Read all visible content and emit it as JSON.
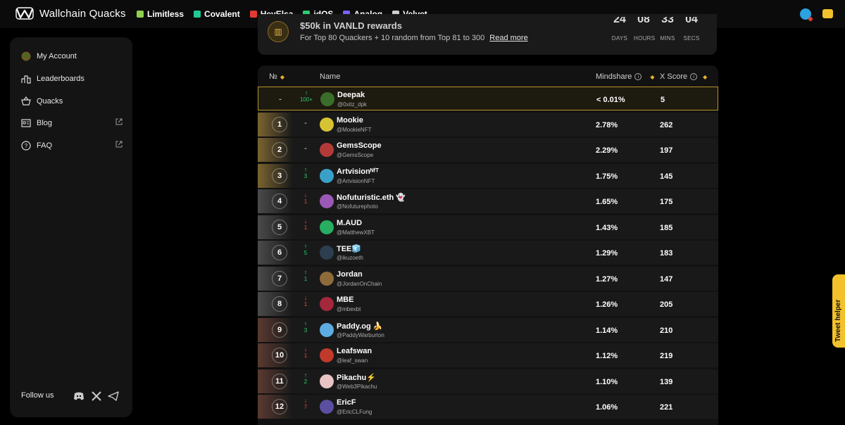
{
  "brand": {
    "name": "Wallchain Quacks"
  },
  "partners": [
    {
      "label": "Limitless",
      "color": "#8fd14f"
    },
    {
      "label": "Covalent",
      "color": "#20c997"
    },
    {
      "label": "HeyElsa",
      "color": "#e53935"
    },
    {
      "label": "idOS",
      "color": "#2ecc71"
    },
    {
      "label": "Analog",
      "color": "#7b61ff"
    },
    {
      "label": "Velvet",
      "color": "#d0d0d0"
    }
  ],
  "sidebar": {
    "items": [
      {
        "label": "My Account",
        "icon": "avatar-icon"
      },
      {
        "label": "Leaderboards",
        "icon": "chart-icon"
      },
      {
        "label": "Quacks",
        "icon": "basket-icon"
      },
      {
        "label": "Blog",
        "icon": "newspaper-icon",
        "external": true
      },
      {
        "label": "FAQ",
        "icon": "question-icon",
        "external": true
      }
    ],
    "follow_label": "Follow us"
  },
  "reward": {
    "title": "$50k in VANLD rewards",
    "description": "For Top 80 Quackers + 10 random from Top 81 to 300",
    "link": "Read more",
    "countdown": [
      {
        "value": "24",
        "label": "DAYS"
      },
      {
        "value": "08",
        "label": "HOURS"
      },
      {
        "value": "33",
        "label": "MINS"
      },
      {
        "value": "04",
        "label": "SECS"
      }
    ]
  },
  "table": {
    "headers": {
      "rank": "№",
      "name": "Name",
      "mindshare": "Mindshare",
      "xscore": "X Score"
    },
    "rows": [
      {
        "rank": "-",
        "change": "100+",
        "dir": "up",
        "name": "Deepak",
        "handle": "@0xitz_dpk",
        "mindshare": "< 0.01%",
        "xscore": "5",
        "me": true,
        "avatar": "#3b6d2a"
      },
      {
        "rank": "1",
        "change": "-",
        "dir": "none",
        "name": "Mookie",
        "handle": "@MookieNFT",
        "mindshare": "2.78%",
        "xscore": "262",
        "avatar": "#d6c233"
      },
      {
        "rank": "2",
        "change": "-",
        "dir": "none",
        "name": "GemsScope",
        "handle": "@GemsScope",
        "mindshare": "2.29%",
        "xscore": "197",
        "avatar": "#b43a3a"
      },
      {
        "rank": "3",
        "change": "3",
        "dir": "up",
        "name": "Artvisionᴺᶠᵀ",
        "handle": "@ArtvisionNFT",
        "mindshare": "1.75%",
        "xscore": "145",
        "avatar": "#3aa0c8"
      },
      {
        "rank": "4",
        "change": "1",
        "dir": "down",
        "name": "Nofuturistic.eth 👻",
        "handle": "@Nofuturephoto",
        "mindshare": "1.65%",
        "xscore": "175",
        "avatar": "#9b59b6"
      },
      {
        "rank": "5",
        "change": "1",
        "dir": "down",
        "name": "M.AUD",
        "handle": "@MatthewXBT",
        "mindshare": "1.43%",
        "xscore": "185",
        "avatar": "#27ae60"
      },
      {
        "rank": "6",
        "change": "5",
        "dir": "up",
        "name": "TEE🧊",
        "handle": "@ikuzoeth",
        "mindshare": "1.29%",
        "xscore": "183",
        "avatar": "#2c3e50"
      },
      {
        "rank": "7",
        "change": "1",
        "dir": "up",
        "name": "Jordan",
        "handle": "@JordanOnChain",
        "mindshare": "1.27%",
        "xscore": "147",
        "avatar": "#8e6b3a"
      },
      {
        "rank": "8",
        "change": "1",
        "dir": "down",
        "name": "MBE",
        "handle": "@mbexbt",
        "mindshare": "1.26%",
        "xscore": "205",
        "avatar": "#a3283a"
      },
      {
        "rank": "9",
        "change": "3",
        "dir": "up",
        "name": "Paddy.og 🍌",
        "handle": "@PaddyWarburton",
        "mindshare": "1.14%",
        "xscore": "210",
        "avatar": "#5dade2"
      },
      {
        "rank": "10",
        "change": "1",
        "dir": "down",
        "name": "Leafswan",
        "handle": "@leaf_swan",
        "mindshare": "1.12%",
        "xscore": "219",
        "avatar": "#c0392b"
      },
      {
        "rank": "11",
        "change": "2",
        "dir": "up",
        "name": "Pikachu⚡",
        "handle": "@Web3Pikachu",
        "mindshare": "1.10%",
        "xscore": "139",
        "avatar": "#e8c4c4"
      },
      {
        "rank": "12",
        "change": "7",
        "dir": "down",
        "name": "EricF",
        "handle": "@EricCLFung",
        "mindshare": "1.06%",
        "xscore": "221",
        "avatar": "#5a4fa0"
      }
    ]
  },
  "tweet_helper": "Tweet helper",
  "colors": {
    "accent": "#f3c12b",
    "up": "#2ecc71",
    "down": "#e74c3c",
    "gold": "#7a6430",
    "silver": "#4a4a4a",
    "bronze": "#5a3a30"
  }
}
